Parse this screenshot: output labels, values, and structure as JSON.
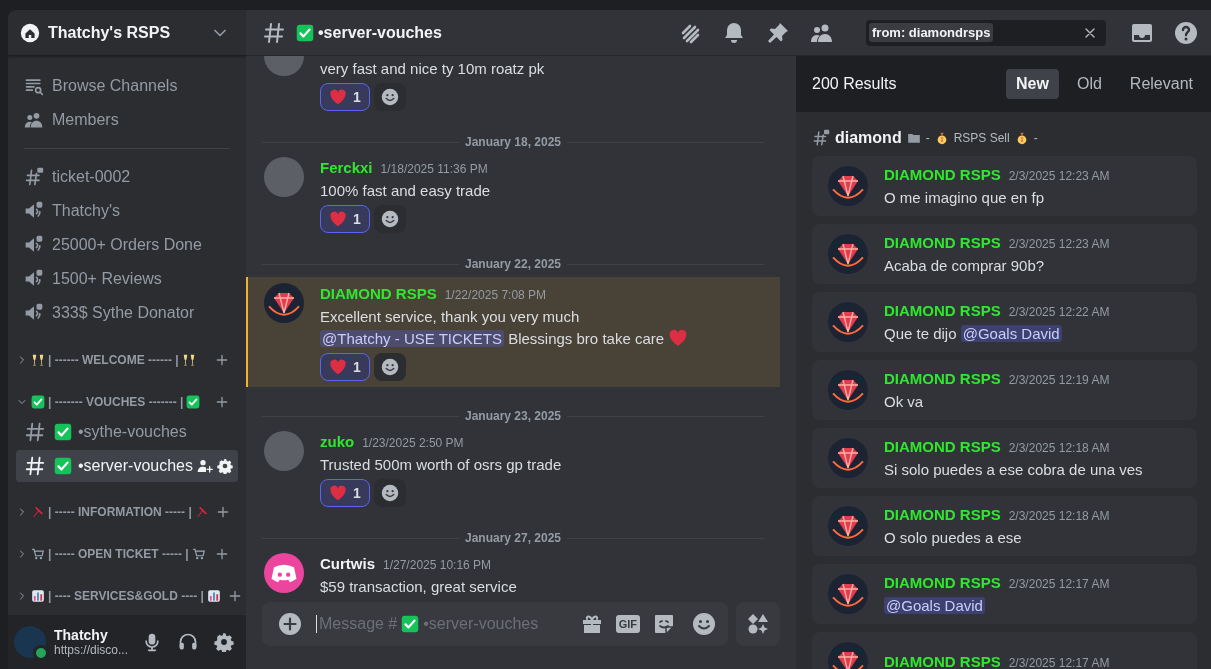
{
  "server": {
    "name": "Thatchy's RSPS"
  },
  "sidebar": {
    "items": [
      {
        "kind": "browse",
        "label": "Browse Channels"
      },
      {
        "kind": "members",
        "label": "Members"
      }
    ],
    "channels": [
      {
        "kind": "locked-text",
        "name": "ticket-0002"
      },
      {
        "kind": "locked-voice",
        "name": "Thatchy's"
      },
      {
        "kind": "locked-voice",
        "name": "25000+ Orders Done"
      },
      {
        "kind": "locked-voice",
        "name": "1500+ Reviews"
      },
      {
        "kind": "locked-voice",
        "name": "333$ Sythe Donator"
      }
    ],
    "categories": [
      {
        "name": "| ------ WELCOME ------ |",
        "expanded": false
      },
      {
        "name": "| ------- VOUCHES ------- |",
        "expanded": true,
        "channels": [
          {
            "name": "•sythe-vouches",
            "selected": false
          },
          {
            "name": "•server-vouches",
            "selected": true
          }
        ]
      },
      {
        "name": "| ----- INFORMATION ----- |",
        "expanded": false
      },
      {
        "name": "| ----- OPEN TICKET ----- |",
        "expanded": false
      },
      {
        "name": "| ---- SERVICES&GOLD ---- |",
        "expanded": false
      }
    ]
  },
  "user": {
    "name": "Thatchy",
    "status_text": "https://disco...",
    "online": true
  },
  "header": {
    "channel": "•server-vouches",
    "search_query": "from: diamondrsps"
  },
  "chat": {
    "messages": [
      {
        "kind": "message",
        "cut": true,
        "avatar": {
          "kind": "photo"
        },
        "highlighted": false,
        "content": [
          {
            "kind": "text",
            "text": "very fast and nice ty 10m roatz pk"
          }
        ],
        "reactions": [
          {
            "count": "1",
            "reacted": true
          }
        ]
      },
      {
        "kind": "divider",
        "date": "January 18, 2025"
      },
      {
        "kind": "message",
        "cut": false,
        "avatar": {
          "kind": "photo"
        },
        "author": "Ferckxi",
        "color": "#2ee82e",
        "time": "1/18/2025 11:36 PM",
        "highlighted": false,
        "content": [
          {
            "kind": "text",
            "text": "100% fast and easy trade"
          }
        ],
        "reactions": [
          {
            "count": "1",
            "reacted": true
          }
        ]
      },
      {
        "kind": "divider",
        "date": "January 22, 2025"
      },
      {
        "kind": "message",
        "cut": false,
        "avatar": {
          "kind": "diamond"
        },
        "author": "DIAMOND RSPS",
        "color": "#2ee82e",
        "time": "1/22/2025 7:08 PM",
        "highlighted": true,
        "content": [
          {
            "kind": "text",
            "text": "Excellent service, thank you very much "
          },
          {
            "kind": "mention",
            "text": "@Thatchy - USE TICKETS"
          },
          {
            "kind": "text",
            "text": " Blessings bro take care "
          },
          {
            "kind": "heart"
          }
        ],
        "reactions": [
          {
            "count": "1",
            "reacted": true
          }
        ]
      },
      {
        "kind": "divider",
        "date": "January 23, 2025"
      },
      {
        "kind": "message",
        "cut": false,
        "avatar": {
          "kind": "photo"
        },
        "author": "zuko",
        "color": "#2ee82e",
        "time": "1/23/2025 2:50 PM",
        "highlighted": false,
        "content": [
          {
            "kind": "text",
            "text": "Trusted 500m worth of osrs gp trade"
          }
        ],
        "reactions": [
          {
            "count": "1",
            "reacted": true
          }
        ]
      },
      {
        "kind": "divider",
        "date": "January 27, 2025"
      },
      {
        "kind": "message",
        "cut": false,
        "avatar": {
          "kind": "discord"
        },
        "author": "Curtwis",
        "color": "#f2f3f5",
        "time": "1/27/2025 10:16 PM",
        "highlighted": false,
        "content": [
          {
            "kind": "text",
            "text": "$59 transaction, great service"
          }
        ]
      }
    ],
    "composer": {
      "placeholder": "Message #",
      "placeholder_channel": "•server-vouches",
      "gif_label": "GIF"
    }
  },
  "search": {
    "results_count": "200 Results",
    "sort_tabs": [
      {
        "label": "New",
        "selected": true
      },
      {
        "label": "Old",
        "selected": false
      },
      {
        "label": "Relevant",
        "selected": false
      }
    ],
    "group": {
      "channel": "diamond",
      "prefix": "-",
      "category": "RSPS Sell",
      "suffix": "-"
    },
    "results": [
      {
        "author": "DIAMOND RSPS",
        "color": "#2ee82e",
        "time": "2/3/2025 12:23 AM",
        "content": [
          {
            "kind": "text",
            "text": "O me imagino que en fp"
          }
        ]
      },
      {
        "author": "DIAMOND RSPS",
        "color": "#2ee82e",
        "time": "2/3/2025 12:23 AM",
        "content": [
          {
            "kind": "text",
            "text": "Acaba de comprar 90b?"
          }
        ]
      },
      {
        "author": "DIAMOND RSPS",
        "color": "#2ee82e",
        "time": "2/3/2025 12:22 AM",
        "content": [
          {
            "kind": "text",
            "text": "Que te dijo "
          },
          {
            "kind": "mention",
            "text": "@Goals David"
          }
        ]
      },
      {
        "author": "DIAMOND RSPS",
        "color": "#2ee82e",
        "time": "2/3/2025 12:19 AM",
        "content": [
          {
            "kind": "text",
            "text": "Ok va"
          }
        ]
      },
      {
        "author": "DIAMOND RSPS",
        "color": "#2ee82e",
        "time": "2/3/2025 12:18 AM",
        "content": [
          {
            "kind": "text",
            "text": "Si solo puedes a ese cobra de una ves"
          }
        ]
      },
      {
        "author": "DIAMOND RSPS",
        "color": "#2ee82e",
        "time": "2/3/2025 12:18 AM",
        "content": [
          {
            "kind": "text",
            "text": "O solo puedes a ese"
          }
        ]
      },
      {
        "author": "DIAMOND RSPS",
        "color": "#2ee82e",
        "time": "2/3/2025 12:17 AM",
        "content": [
          {
            "kind": "mention",
            "text": "@Goals David"
          }
        ]
      },
      {
        "author": "DIAMOND RSPS",
        "color": "#2ee82e",
        "time": "2/3/2025 12:17 AM"
      }
    ]
  }
}
